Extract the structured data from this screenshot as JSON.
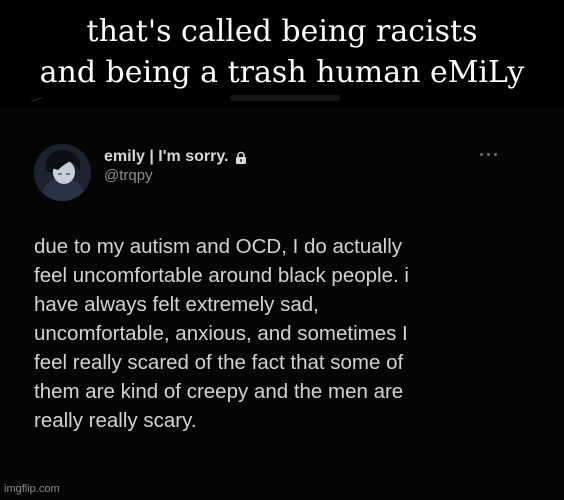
{
  "caption": {
    "line1": "that's called being racists",
    "line2": "and being a trash human eMiLy"
  },
  "tweet": {
    "display_name": "emily | I'm sorry.",
    "handle": "@trqpy",
    "body_lines": [
      "due to my autism and OCD, I do actually",
      "feel uncomfortable around black people. i",
      "have always felt extremely sad,",
      "uncomfortable, anxious, and sometimes I",
      "feel really scared of the fact that some of",
      "them are kind of creepy and the men are",
      "really really scary."
    ],
    "icons": {
      "lock": "lock-icon",
      "more": "more-options-icon",
      "back": "back-arrow-icon"
    }
  },
  "watermark": "imgflip.com",
  "colors": {
    "background": "#000000",
    "text": "#d3d3d3",
    "secondary": "#8b8f94"
  }
}
